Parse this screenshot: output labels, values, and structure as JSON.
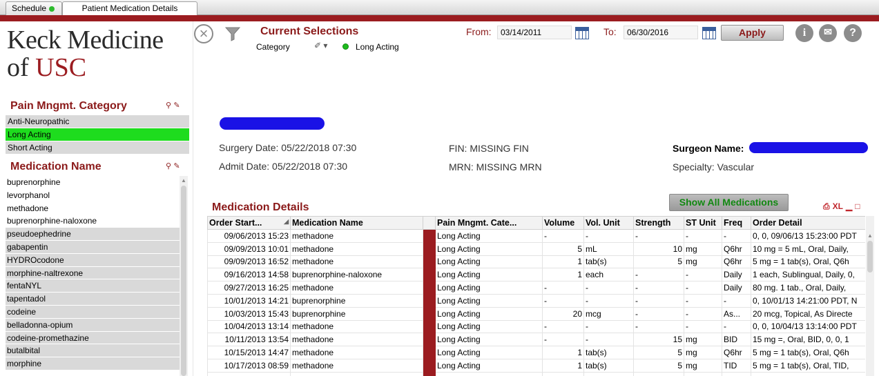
{
  "tabs": [
    {
      "label": "Schedule"
    },
    {
      "label": "Patient Medication Details"
    }
  ],
  "logo": {
    "line1": "Keck Medicine",
    "line2_prefix": "of",
    "line2_brand": "USC"
  },
  "pain_category": {
    "title": "Pain Mngmt. Category",
    "items": [
      "Anti-Neuropathic",
      "Long Acting",
      "Short Acting"
    ],
    "selected": "Long Acting"
  },
  "medication_list": {
    "title": "Medication Name",
    "items": [
      {
        "label": "buprenorphine",
        "state": "possible"
      },
      {
        "label": "levorphanol",
        "state": "possible"
      },
      {
        "label": "methadone",
        "state": "possible"
      },
      {
        "label": "buprenorphine-naloxone",
        "state": "possible"
      },
      {
        "label": "pseudoephedrine",
        "state": "excluded"
      },
      {
        "label": "gabapentin",
        "state": "excluded"
      },
      {
        "label": "HYDROcodone",
        "state": "excluded"
      },
      {
        "label": "morphine-naltrexone",
        "state": "excluded"
      },
      {
        "label": "fentaNYL",
        "state": "excluded"
      },
      {
        "label": "tapentadol",
        "state": "excluded"
      },
      {
        "label": "codeine",
        "state": "excluded"
      },
      {
        "label": "belladonna-opium",
        "state": "excluded"
      },
      {
        "label": "codeine-promethazine",
        "state": "excluded"
      },
      {
        "label": "butalbital",
        "state": "excluded"
      },
      {
        "label": "morphine",
        "state": "excluded"
      }
    ]
  },
  "current_selections": {
    "title": "Current Selections",
    "field": "Category",
    "value": "Long Acting"
  },
  "dates": {
    "from_label": "From:",
    "from_value": "03/14/2011",
    "to_label": "To:",
    "to_value": "06/30/2016",
    "apply_label": "Apply"
  },
  "header_icons": {
    "info": "i",
    "mail": "✉",
    "help": "?"
  },
  "patient": {
    "surgery_date": "Surgery Date: 05/22/2018 07:30",
    "admit_date": "Admit Date: 05/22/2018 07:30",
    "fin": "FIN: MISSING FIN",
    "mrn": "MRN: MISSING MRN",
    "surgeon_label": "Surgeon Name:",
    "specialty": "Specialty: Vascular"
  },
  "med_details": {
    "title": "Medication Details",
    "show_all_label": "Show All Medications",
    "xl_label": "XL",
    "columns": [
      "Order Start...",
      "Medication Name",
      "",
      "Pain Mngmt. Cate...",
      "Volume",
      "Vol. Unit",
      "Strength",
      "ST Unit",
      "Freq",
      "Order Detail"
    ],
    "rows": [
      [
        "09/06/2013 15:23",
        "methadone",
        "",
        "Long Acting",
        "-",
        "-",
        "-",
        "-",
        "-",
        "0, 0, 09/06/13 15:23:00 PDT"
      ],
      [
        "09/09/2013 10:01",
        "methadone",
        "",
        "Long Acting",
        "5",
        "mL",
        "10",
        "mg",
        "Q6hr",
        "10 mg = 5 mL, Oral, Daily,"
      ],
      [
        "09/09/2013 16:52",
        "methadone",
        "",
        "Long Acting",
        "1",
        "tab(s)",
        "5",
        "mg",
        "Q6hr",
        "5 mg = 1 tab(s), Oral, Q6h"
      ],
      [
        "09/16/2013 14:58",
        "buprenorphine-naloxone",
        "",
        "Long Acting",
        "1",
        "each",
        "-",
        "-",
        "Daily",
        "1 each, Sublingual, Daily, 0,"
      ],
      [
        "09/27/2013 16:25",
        "methadone",
        "",
        "Long Acting",
        "-",
        "-",
        "-",
        "-",
        "Daily",
        "80 mg.  1 tab., Oral, Daily,"
      ],
      [
        "10/01/2013 14:21",
        "buprenorphine",
        "",
        "Long Acting",
        "-",
        "-",
        "-",
        "-",
        "-",
        "0, 10/01/13 14:21:00 PDT, N"
      ],
      [
        "10/03/2013 15:43",
        "buprenorphine",
        "",
        "Long Acting",
        "20",
        "mcg",
        "-",
        "-",
        "As...",
        "20 mcg, Topical, As Directe"
      ],
      [
        "10/04/2013 13:14",
        "methadone",
        "",
        "Long Acting",
        "-",
        "-",
        "-",
        "-",
        "-",
        "0, 0, 10/04/13 13:14:00 PDT"
      ],
      [
        "10/11/2013 13:54",
        "methadone",
        "",
        "Long Acting",
        "-",
        "-",
        "15",
        "mg",
        "BID",
        "15 mg =, Oral, BID, 0, 0, 1"
      ],
      [
        "10/15/2013 14:47",
        "methadone",
        "",
        "Long Acting",
        "1",
        "tab(s)",
        "5",
        "mg",
        "Q6hr",
        "5 mg = 1 tab(s), Oral, Q6h"
      ],
      [
        "10/17/2013 08:59",
        "methadone",
        "",
        "Long Acting",
        "1",
        "tab(s)",
        "5",
        "mg",
        "TID",
        "5 mg = 1 tab(s), Oral, TID,"
      ],
      [
        "",
        "",
        "",
        "",
        "",
        "",
        "",
        "",
        "",
        ""
      ]
    ]
  },
  "colors": {
    "brand_red": "#9b1c20",
    "selected_green": "#1edc1e",
    "excluded_gray": "#d9d9d9",
    "redaction_blue": "#1a12e6"
  }
}
